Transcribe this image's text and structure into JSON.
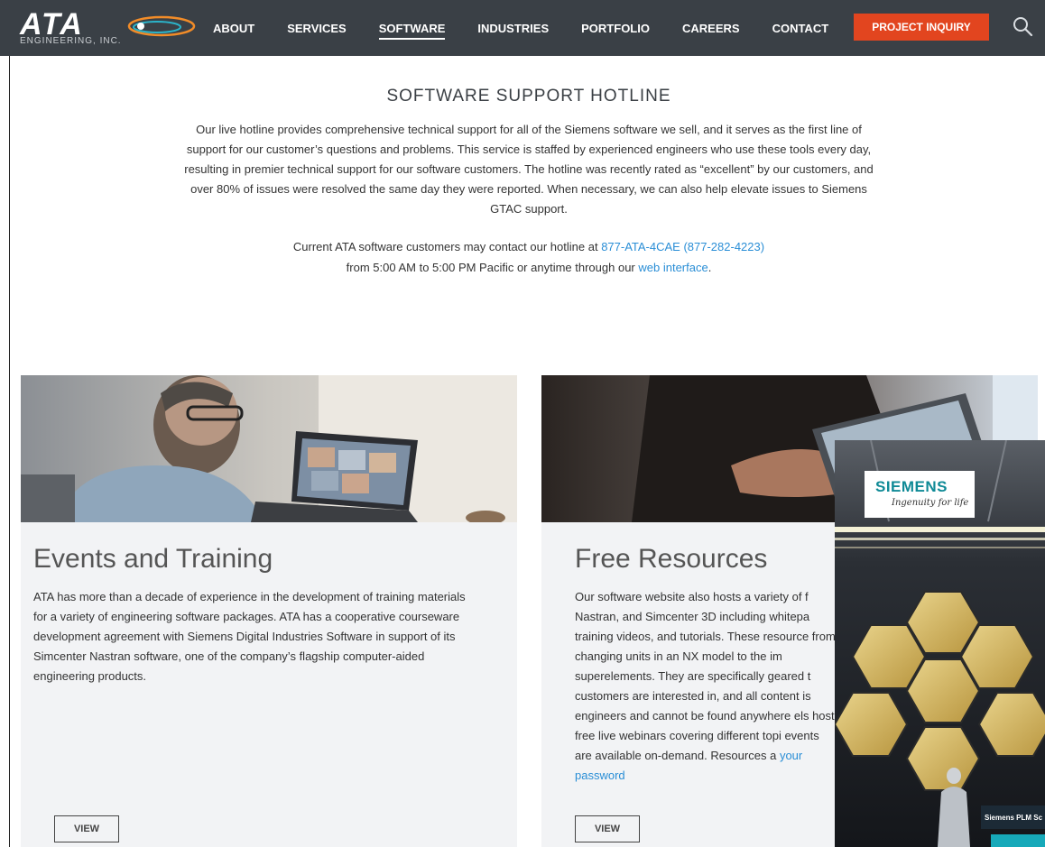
{
  "header": {
    "logo_text": "ATA",
    "logo_sub": "ENGINEERING, INC.",
    "nav": [
      {
        "label": "ABOUT"
      },
      {
        "label": "SERVICES"
      },
      {
        "label": "SOFTWARE"
      },
      {
        "label": "INDUSTRIES"
      },
      {
        "label": "PORTFOLIO"
      },
      {
        "label": "CAREERS"
      },
      {
        "label": "CONTACT"
      }
    ],
    "active_nav": "SOFTWARE",
    "inquiry_label": "PROJECT INQUIRY",
    "search_icon": "search-icon"
  },
  "hotline": {
    "title": "SOFTWARE SUPPORT HOTLINE",
    "body": "Our live hotline provides comprehensive technical support for all of the Siemens software we sell, and it serves as the first line of support for our customer’s questions and problems. This service is staffed by experienced engineers who use these tools every day, resulting in premier technical support for our software customers. The hotline was recently rated as “excellent” by our customers, and over 80% of issues were resolved the same day they were reported. When necessary, we can also help elevate issues to Siemens GTAC support.",
    "contact_prefix": "Current ATA software customers may contact our hotline at ",
    "phone_link": "877-ATA-4CAE (877-282-4223)",
    "hours_prefix": "from 5:00 AM to 5:00 PM Pacific or anytime through our ",
    "web_link": "web interface",
    "hours_suffix": "."
  },
  "cards": [
    {
      "title": "Events and Training",
      "text": "ATA has more than a decade of experience in the development of training materials for a variety of engineering software packages. ATA has a cooperative courseware development agreement with Siemens Digital Industries Software in support of its Simcenter Nastran software, one of the company’s flagship computer-aided engineering products.",
      "button": "VIEW"
    },
    {
      "title": "Free Resources",
      "text": "Our software website also hosts a variety of f Nastran, and Simcenter 3D including whitepa training videos, and tutorials. These resource from changing units in an NX model to the im superelements. They are specifically geared t customers are interested in, and all content is engineers and cannot be found anywhere els host free live webinars covering different topi events are available on-demand. Resources a",
      "link": "your password",
      "button": "VIEW"
    }
  ],
  "ad": {
    "brand": "SIEMENS",
    "tagline": "Ingenuity for life",
    "footer": "Siemens PLM Sc"
  },
  "colors": {
    "header_bg": "#3a4046",
    "inquiry_bg": "#e2451f",
    "link": "#2a8ed6",
    "card_bg": "#f2f3f5",
    "siemens_teal": "#0f8a96"
  }
}
